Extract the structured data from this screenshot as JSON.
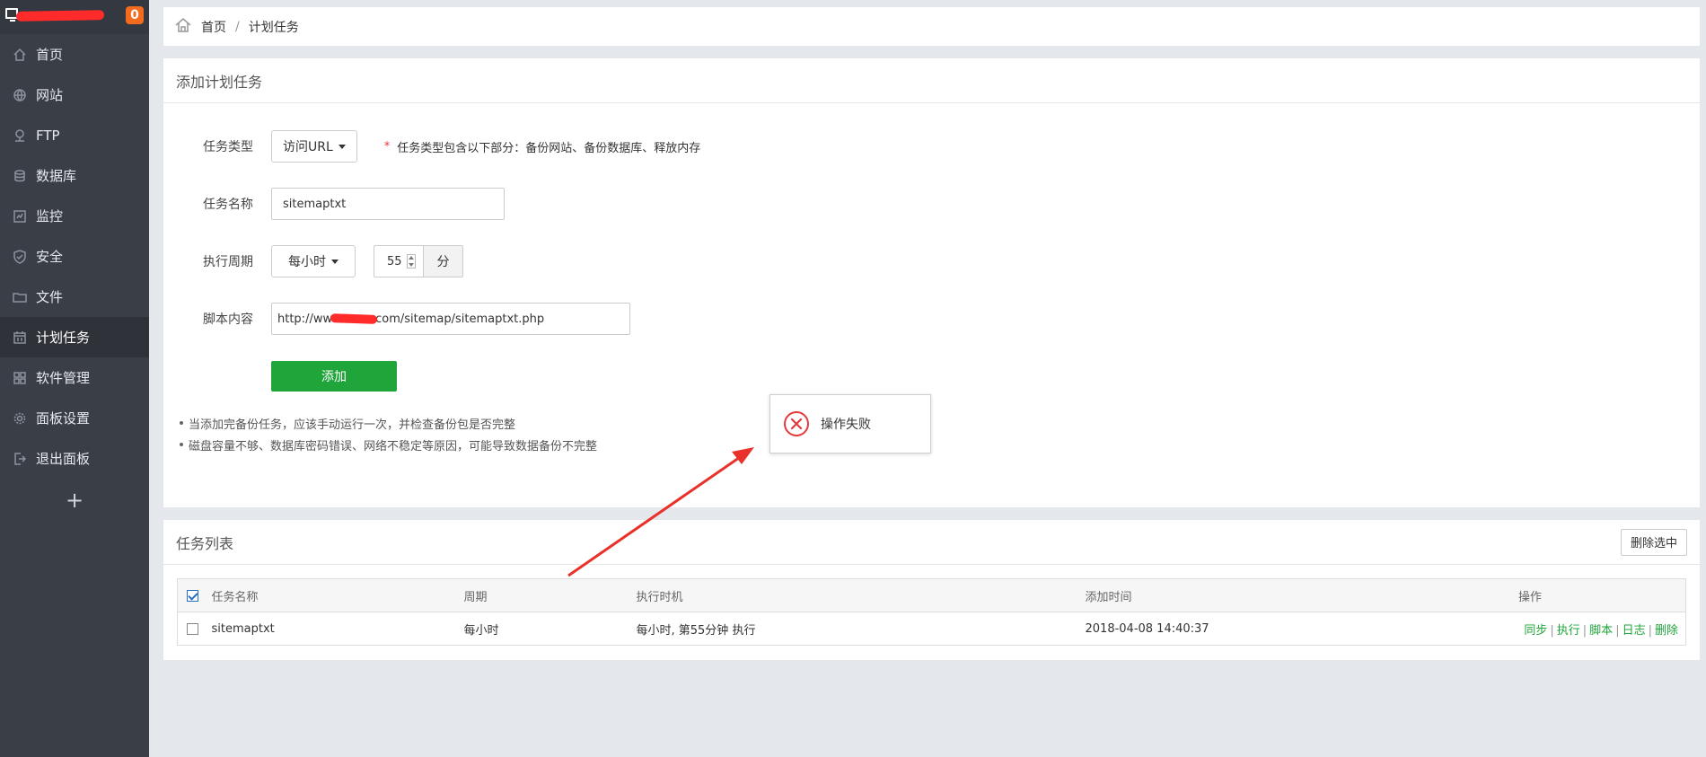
{
  "sidebar": {
    "badge": "0",
    "items": [
      {
        "label": "首页",
        "icon": "home-icon"
      },
      {
        "label": "网站",
        "icon": "globe-icon"
      },
      {
        "label": "FTP",
        "icon": "ftp-icon"
      },
      {
        "label": "数据库",
        "icon": "database-icon"
      },
      {
        "label": "监控",
        "icon": "monitor-icon"
      },
      {
        "label": "安全",
        "icon": "shield-icon"
      },
      {
        "label": "文件",
        "icon": "folder-icon"
      },
      {
        "label": "计划任务",
        "icon": "calendar-icon"
      },
      {
        "label": "软件管理",
        "icon": "apps-icon"
      },
      {
        "label": "面板设置",
        "icon": "gear-icon"
      },
      {
        "label": "退出面板",
        "icon": "logout-icon"
      }
    ],
    "active_index": 7,
    "add": "+"
  },
  "breadcrumb": {
    "home": "首页",
    "sep": "/",
    "current": "计划任务"
  },
  "add_panel": {
    "title": "添加计划任务",
    "task_type_label": "任务类型",
    "task_type_value": "访问URL",
    "task_type_note_star": "*",
    "task_type_note": "任务类型包含以下部分：备份网站、备份数据库、释放内存",
    "task_name_label": "任务名称",
    "task_name_value": "sitemaptxt",
    "period_label": "执行周期",
    "period_value": "每小时",
    "minute_value": "55",
    "minute_unit": "分",
    "script_label": "脚本内容",
    "script_value_prefix": "http://ww",
    "script_value_suffix": "com/sitemap/sitemaptxt.php",
    "add_button": "添加",
    "tips": [
      "当添加完备份任务，应该手动运行一次，并检查备份包是否完整",
      "磁盘容量不够、数据库密码错误、网络不稳定等原因，可能导致数据备份不完整"
    ]
  },
  "toast": {
    "message": "操作失败",
    "icon": "error-circle-icon"
  },
  "task_list": {
    "title": "任务列表",
    "delete_selected": "删除选中",
    "columns": [
      "任务名称",
      "周期",
      "执行时机",
      "添加时间",
      "操作"
    ],
    "rows": [
      {
        "name": "sitemaptxt",
        "period": "每小时",
        "timing": "每小时, 第55分钟 执行",
        "added": "2018-04-08 14:40:37"
      }
    ],
    "ops": [
      "同步",
      "执行",
      "脚本",
      "日志",
      "删除"
    ]
  },
  "colors": {
    "accent_green": "#20a53a",
    "sidebar_bg": "#3a3f47",
    "badge_orange": "#f36b1c",
    "error_red": "#e4393c"
  }
}
